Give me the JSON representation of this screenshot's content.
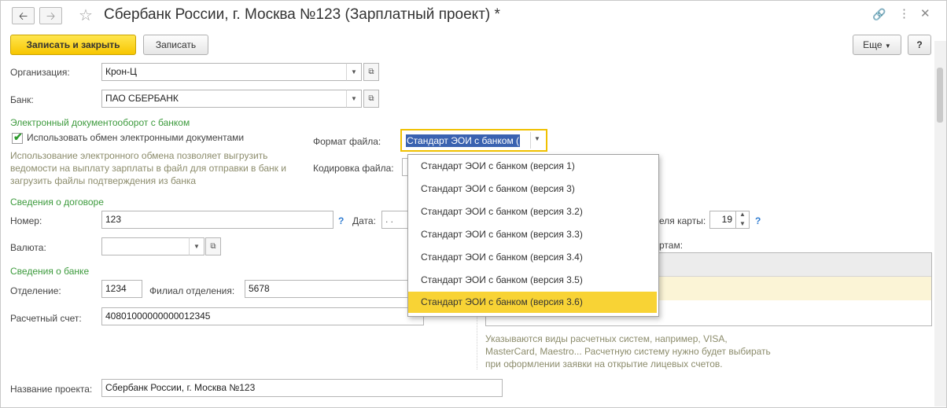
{
  "window": {
    "title": "Сбербанк России, г. Москва №123 (Зарплатный проект) *",
    "back_icon": "arrow-left-icon",
    "forward_icon": "arrow-right-icon",
    "favorite_icon": "star-icon",
    "link_icon": "link-icon",
    "menu_icon": "more-vertical-icon",
    "close_icon": "close-icon"
  },
  "toolbar": {
    "save_close_label": "Записать и закрыть",
    "save_label": "Записать",
    "more_label": "Еще",
    "help_label": "?"
  },
  "form": {
    "organization": {
      "label": "Организация:",
      "value": "Крон-Ц"
    },
    "bank": {
      "label": "Банк:",
      "value": "ПАО СБЕРБАНК"
    },
    "edo_group": "Электронный документооборот с банком",
    "use_edo": {
      "label": "Использовать обмен электронными документами",
      "checked": true
    },
    "edo_hint": [
      "Использование электронного обмена позволяет выгрузить",
      "ведомости на выплату зарплаты в файл для отправки в банк и",
      "загрузить файлы подтверждения из банка"
    ],
    "file_format": {
      "label": "Формат файла:",
      "value": "Стандарт ЭОИ с банком ("
    },
    "encoding": {
      "label": "Кодировка файла:"
    },
    "contract_group": "Сведения о договоре",
    "number": {
      "label": "Номер:",
      "value": "123"
    },
    "date": {
      "label": "Дата:",
      "value": ". ."
    },
    "card_term": {
      "label": "еля карты:",
      "value": "19"
    },
    "currency": {
      "label": "Валюта:",
      "value": ""
    },
    "cards_label": "ртам:",
    "bank_group": "Сведения о банке",
    "branch": {
      "label": "Отделение:",
      "value": "1234"
    },
    "sub_branch": {
      "label": "Филиал отделения:",
      "value": "5678"
    },
    "account": {
      "label": "Расчетный счет:",
      "value": "40801000000000012345"
    },
    "payment_hint": [
      "Указываются виды расчетных систем, например, VISA,",
      "MasterCard, Maestro... Расчетную систему нужно будет выбирать",
      "при оформлении заявки на открытие лицевых счетов."
    ],
    "project_name": {
      "label": "Название проекта:",
      "value": "Сбербанк России, г. Москва №123"
    },
    "question_mark": "?"
  },
  "dropdown": {
    "options": [
      "Стандарт ЭОИ с банком (версия 1)",
      "Стандарт ЭОИ с банком (версия 3)",
      "Стандарт ЭОИ с банком (версия 3.2)",
      "Стандарт ЭОИ с банком (версия 3.3)",
      "Стандарт ЭОИ с банком (версия 3.4)",
      "Стандарт ЭОИ с банком (версия 3.5)",
      "Стандарт ЭОИ с банком (версия 3.6)"
    ],
    "selected_index": 6
  },
  "colors": {
    "accent_yellow": "#f8d335",
    "group_green": "#3c9a3c",
    "hint_text": "#8c8c6c",
    "help_blue": "#2f7cd1"
  }
}
